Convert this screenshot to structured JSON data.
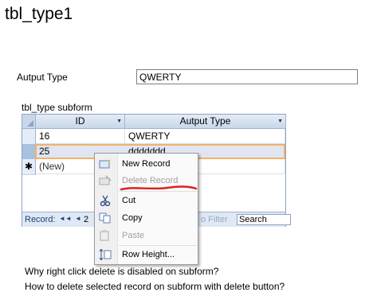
{
  "form_title": "tbl_type1",
  "autput_type_label": "Autput Type",
  "autput_type_value": "QWERTY",
  "subform": {
    "caption": "tbl_type subform",
    "columns": [
      "ID",
      "Autput Type"
    ],
    "rows": [
      {
        "id": "16",
        "type": "QWERTY"
      },
      {
        "id": "25",
        "type": "ddddddd"
      }
    ],
    "new_row_marker": "✱",
    "new_row_label": "(New)",
    "navbar": {
      "record_label": "Record:",
      "first_btn": "◄◄",
      "prev_btn": "◄",
      "current": "2",
      "filter_label": "o Filter",
      "search_label": "Search"
    }
  },
  "context_menu": {
    "items": [
      {
        "label": "New Record",
        "icon": "new-record-icon",
        "enabled": true
      },
      {
        "label": "Delete Record",
        "icon": "delete-record-icon",
        "enabled": false
      },
      {
        "label": "Cut",
        "icon": "scissors-icon",
        "enabled": true
      },
      {
        "label": "Copy",
        "icon": "copy-icon",
        "enabled": true
      },
      {
        "label": "Paste",
        "icon": "paste-icon",
        "enabled": false
      },
      {
        "label": "Row Height...",
        "icon": "row-height-icon",
        "enabled": true
      }
    ]
  },
  "questions": [
    "Why right click delete is disabled on subform?",
    "How to delete selected record on subform with delete button?"
  ],
  "colors": {
    "selected_row_border": "#f5b16a",
    "header_bg": "#c9d7ea",
    "annotation_red": "#e02020"
  }
}
